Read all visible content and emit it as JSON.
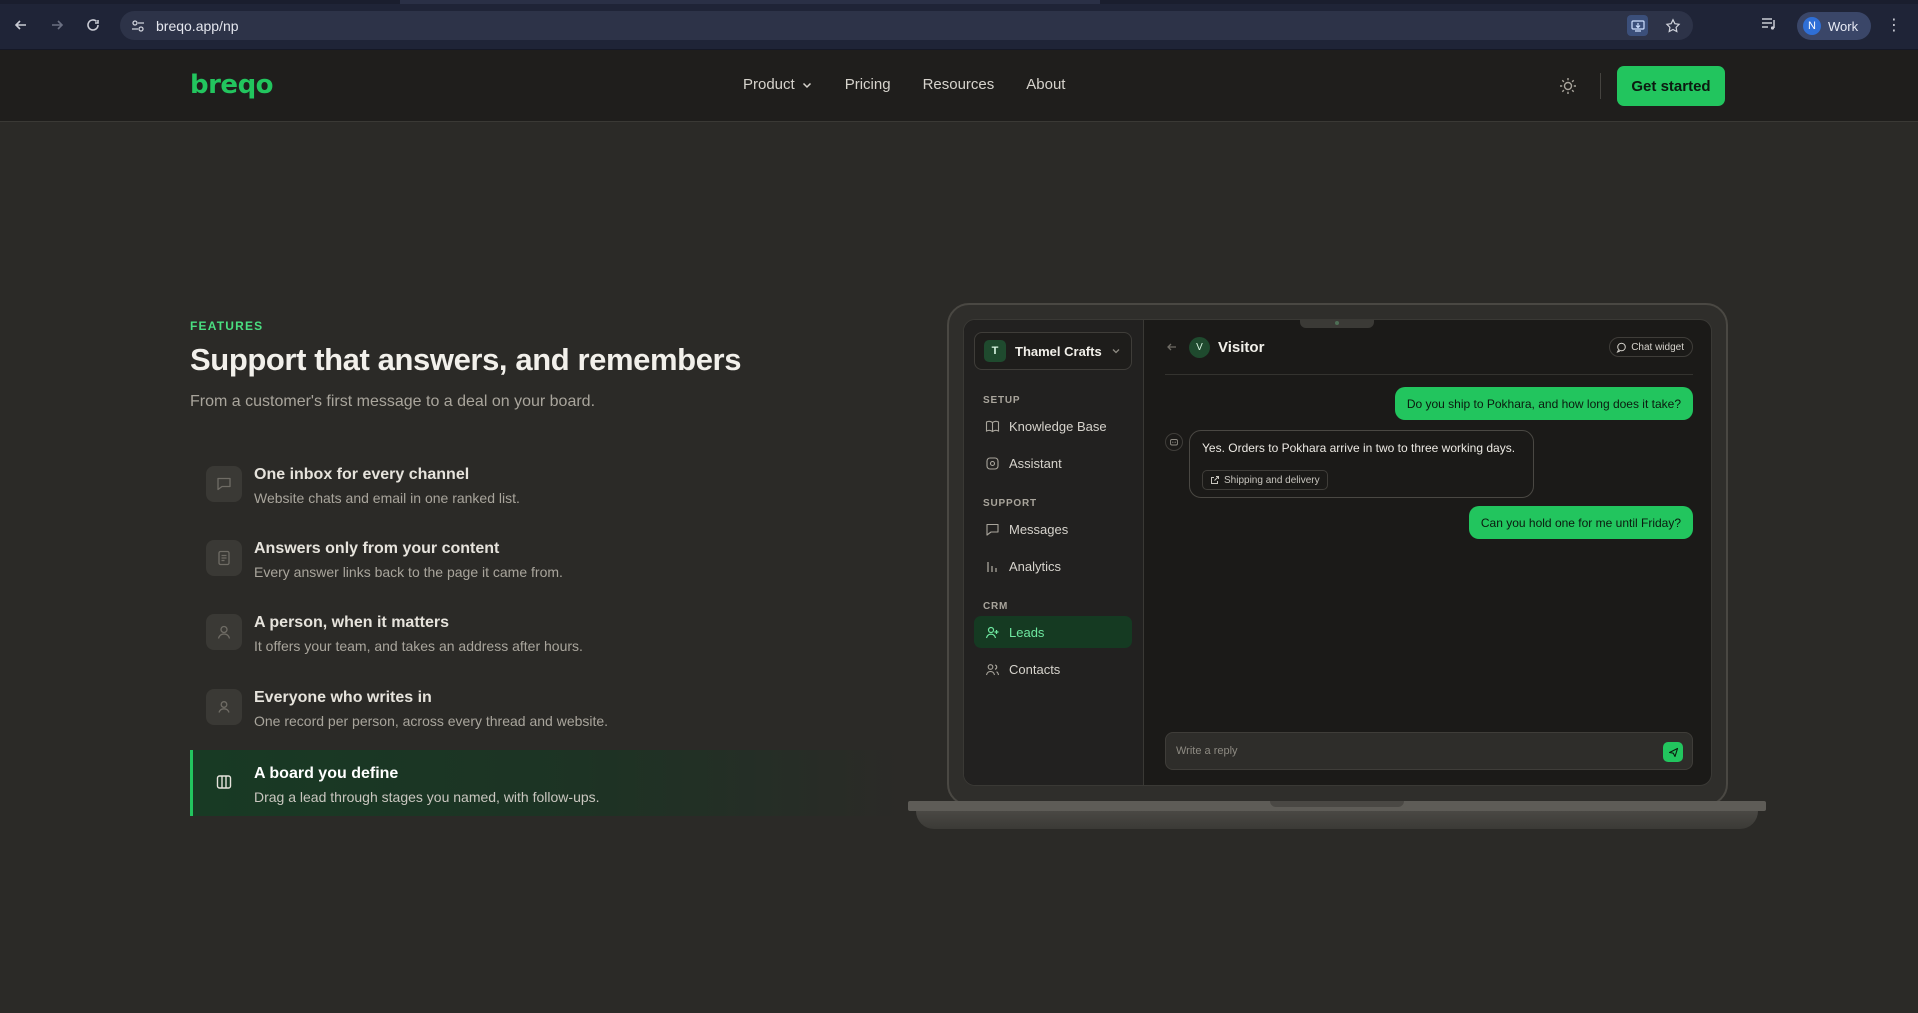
{
  "browser": {
    "url": "breqo.app/np",
    "profile": {
      "initial": "N",
      "label": "Work"
    }
  },
  "site": {
    "logo": "breqo",
    "menu": [
      {
        "label": "Product",
        "has_dropdown": true
      },
      {
        "label": "Pricing"
      },
      {
        "label": "Resources"
      },
      {
        "label": "About"
      }
    ],
    "cta": "Get started"
  },
  "features": {
    "eyebrow": "FEATURES",
    "headline": "Support that answers, and remembers",
    "subhead": "From a customer's first message to a deal on your board.",
    "items": [
      {
        "icon": "chat-bubble-icon",
        "title": "One inbox for every channel",
        "desc": "Website chats and email in one ranked list."
      },
      {
        "icon": "document-icon",
        "title": "Answers only from your content",
        "desc": "Every answer links back to the page it came from."
      },
      {
        "icon": "person-icon",
        "title": "A person, when it matters",
        "desc": "It offers your team, and takes an address after hours."
      },
      {
        "icon": "person-card-icon",
        "title": "Everyone who writes in",
        "desc": "One record per person, across every thread and website."
      },
      {
        "icon": "board-columns-icon",
        "title": "A board you define",
        "desc": "Drag a lead through stages you named, with follow-ups.",
        "active": true
      }
    ]
  },
  "app": {
    "workspace": {
      "initial": "T",
      "name": "Thamel Crafts"
    },
    "sections": {
      "setup": "SETUP",
      "support": "SUPPORT",
      "crm": "CRM"
    },
    "nav": {
      "knowledge_base": "Knowledge Base",
      "assistant": "Assistant",
      "messages": "Messages",
      "analytics": "Analytics",
      "leads": "Leads",
      "contacts": "Contacts"
    },
    "conversation": {
      "visitor_initial": "V",
      "visitor_name": "Visitor",
      "channel_chip": "Chat widget",
      "messages": [
        {
          "from": "visitor",
          "text": "Do you ship to Pokhara, and how long does it take?"
        },
        {
          "from": "assistant",
          "text": "Yes. Orders to Pokhara arrive in two to three working days.",
          "source": "Shipping and delivery"
        },
        {
          "from": "visitor",
          "text": "Can you hold one for me until Friday?"
        }
      ],
      "reply_placeholder": "Write a reply"
    }
  },
  "colors": {
    "accent": "#22c55e",
    "background": "#2b2a27",
    "nav_background": "#1f1e1c"
  }
}
